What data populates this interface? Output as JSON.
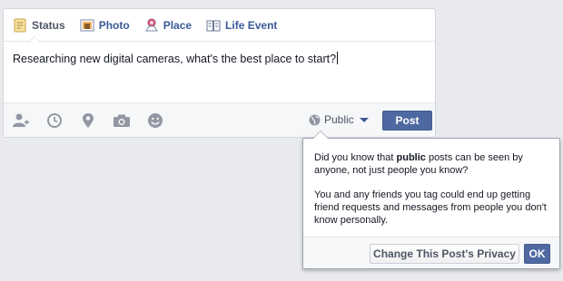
{
  "composer": {
    "tabs": [
      {
        "label": "Status",
        "icon": "status-icon"
      },
      {
        "label": "Photo",
        "icon": "photo-icon"
      },
      {
        "label": "Place",
        "icon": "place-icon"
      },
      {
        "label": "Life Event",
        "icon": "life-event-icon"
      }
    ],
    "text": "Researching new digital cameras, what's the best place to start?",
    "footer_icons": [
      "tag-friends-icon",
      "clock-icon",
      "location-pin-icon",
      "camera-icon",
      "smiley-icon"
    ],
    "privacy_label": "Public",
    "post_label": "Post"
  },
  "tooltip": {
    "line1_pre": "Did you know that ",
    "line1_bold": "public",
    "line1_post": " posts can be seen by anyone, not just people you know?",
    "line2": "You and any friends you tag could end up getting friend requests and messages from people you don't know personally.",
    "change_label": "Change This Post's Privacy",
    "ok_label": "OK"
  },
  "colors": {
    "brand": "#3b5998",
    "button": "#4e69a2",
    "background": "#e9eaed"
  }
}
